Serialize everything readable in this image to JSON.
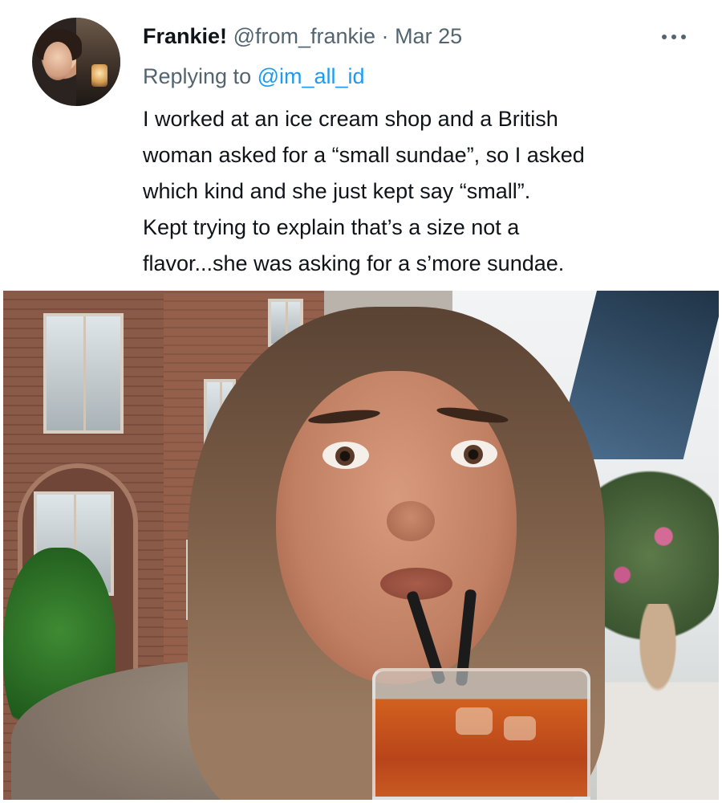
{
  "tweet": {
    "display_name": "Frankie!",
    "handle": "@from_frankie",
    "separator": "·",
    "date": "Mar 25",
    "reply_prefix": "Replying to",
    "reply_to": "@im_all_id",
    "text_lines": [
      "I worked at an ice cream shop and a British",
      "woman asked for a “small sundae”, so I asked",
      "which kind and she just kept say “small”.",
      "Kept trying to explain that’s a size not a",
      "flavor...she was asking for a s’more sundae."
    ],
    "more_icon": "more-horizontal-icon"
  },
  "colors": {
    "text_primary": "#0f1419",
    "text_secondary": "#536471",
    "link": "#1d9bf0"
  }
}
